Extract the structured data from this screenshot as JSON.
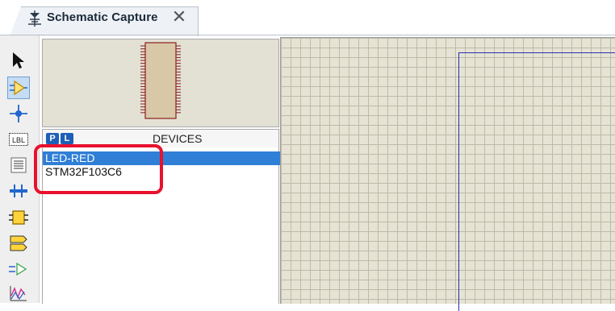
{
  "tab": {
    "title": "Schematic Capture",
    "close_glyph": "✕",
    "icon": "schematic-icon"
  },
  "toolbar": {
    "tools": [
      {
        "name": "selection-mode-icon",
        "selected": false
      },
      {
        "name": "component-mode-icon",
        "selected": true
      },
      {
        "name": "junction-dot-icon",
        "selected": false
      },
      {
        "name": "wire-label-icon",
        "text": "LBL",
        "selected": false
      },
      {
        "name": "text-script-icon",
        "selected": false
      },
      {
        "name": "buses-icon",
        "selected": false
      },
      {
        "name": "subcircuit-icon",
        "selected": false
      },
      {
        "name": "terminals-icon",
        "selected": false
      },
      {
        "name": "device-pins-icon",
        "selected": false
      },
      {
        "name": "graph-icon",
        "selected": false
      }
    ]
  },
  "devices": {
    "title": "DEVICES",
    "pick_button": "P",
    "library_button": "L",
    "items": [
      "LED-RED",
      "STM32F103C6"
    ],
    "selected_index": 0
  },
  "colors": {
    "selection": "#2f7fd6",
    "highlight": "#e8112d",
    "sheet_border": "#2a2fb0",
    "canvas": "#e6e3d4"
  }
}
